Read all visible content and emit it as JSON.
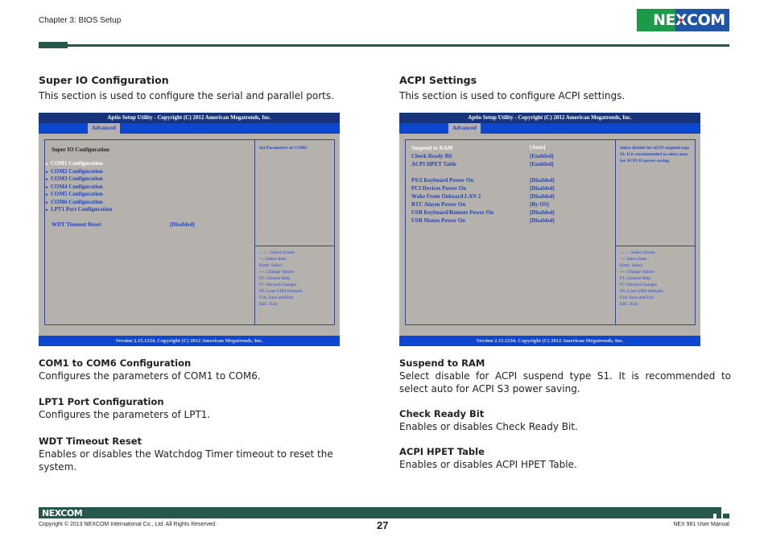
{
  "header": {
    "chapter": "Chapter 3: BIOS Setup",
    "logo": {
      "ne": "NE",
      "com": "COM",
      "x": "X"
    },
    "colors": {
      "brand_green": "#1c9a48",
      "brand_blue": "#1e55a5",
      "rule": "#25574a"
    }
  },
  "left": {
    "title": "Super IO Configuration",
    "description": "This section is used to configure the serial and parallel ports.",
    "bios": {
      "title_bar": "Aptio Setup Utility - Copyright (C) 2012 American Megatrends, Inc.",
      "tab": "Advanced",
      "screen_title": "Super IO Configuration",
      "items": [
        {
          "label": "COM1 Configuration",
          "submenu": true,
          "selected": true
        },
        {
          "label": "COM2 Configuration",
          "submenu": true,
          "selected": false
        },
        {
          "label": "COM3 Configuration",
          "submenu": true,
          "selected": false
        },
        {
          "label": "COM4 Configuration",
          "submenu": true,
          "selected": false
        },
        {
          "label": "COM5 Configuration",
          "submenu": true,
          "selected": false
        },
        {
          "label": "COM6 Configuration",
          "submenu": true,
          "selected": false
        },
        {
          "label": "LPT1 Port Configuration",
          "submenu": true,
          "selected": false
        }
      ],
      "settings": [
        {
          "label": "WDT Timeout Reset",
          "value": "[Disabled]"
        }
      ],
      "help": "Set Parameters of COM1",
      "keys": [
        "→←: Select Screen",
        "↑↓: Select Item",
        "Enter: Select",
        "+/-: Change Option",
        "F1: General Help",
        "F7: Discard Changes",
        "F9: Load UEFI Defaults",
        "F10: Save and Exit",
        "ESC: Exit"
      ],
      "footer": "Version 2.15.1234. Copyright (C) 2012 American Megatrends, Inc."
    },
    "descriptions": [
      {
        "heading": "COM1 to COM6 Configuration",
        "text": "Configures the parameters of COM1 to COM6."
      },
      {
        "heading": "LPT1 Port Configuration",
        "text": "Configures the parameters of LPT1."
      },
      {
        "heading": "WDT Timeout Reset",
        "text": "Enables or disables the Watchdog Timer timeout to reset the system."
      }
    ]
  },
  "right": {
    "title": "ACPI Settings",
    "description": "This section is used to configure ACPI settings.",
    "bios": {
      "title_bar": "Aptio Setup Utility - Copyright (C) 2012 American Megatrends, Inc.",
      "tab": "Advanced",
      "settings": [
        {
          "label": "Suspend to RAM",
          "value": "[Auto]",
          "selected": true
        },
        {
          "label": "Check Ready Bit",
          "value": "[Enabled]",
          "selected": false
        },
        {
          "label": "ACPI HPET Table",
          "value": "[Enabled]",
          "selected": false
        },
        {
          "label": "PS/2 Keyboard Power On",
          "value": "[Disabled]",
          "selected": false
        },
        {
          "label": "PCI Devices Power On",
          "value": "[Disabled]",
          "selected": false
        },
        {
          "label": "Wake From Onboard LAN 2",
          "value": "[Disabled]",
          "selected": false
        },
        {
          "label": "RTC Alarm Power On",
          "value": "[By OS]",
          "selected": false
        },
        {
          "label": "USB Keyboard/Remote Power On",
          "value": "[Disabled]",
          "selected": false
        },
        {
          "label": "USB Mouse Power On",
          "value": "[Disabled]",
          "selected": false
        }
      ],
      "help": "Select disable for ACPI suspend type S1. It is recommended to select auto for ACPI S3 power saving.",
      "keys": [
        "→←: Select Screen",
        "↑↓: Select Item",
        "Enter: Select",
        "+/-: Change Option",
        "F1: General Help",
        "F7: Discard Changes",
        "F9: Load UEFI Defaults",
        "F10: Save and Exit",
        "ESC: Exit"
      ],
      "footer": "Version 2.15.1234. Copyright (C) 2012 American Megatrends, Inc."
    },
    "descriptions": [
      {
        "heading": "Suspend to RAM",
        "text": "Select disable for ACPI suspend type S1. It is recommended to select auto for ACPI S3 power saving."
      },
      {
        "heading": "Check Ready Bit",
        "text": "Enables or disables Check Ready Bit."
      },
      {
        "heading": "ACPI HPET Table",
        "text": "Enables or disables ACPI HPET Table."
      }
    ]
  },
  "footer": {
    "logo": "NEXCOM",
    "copyright": "Copyright © 2013 NEXCOM International Co., Ltd. All Rights Reserved.",
    "page_number": "27",
    "manual": "NEX 981 User Manual"
  }
}
